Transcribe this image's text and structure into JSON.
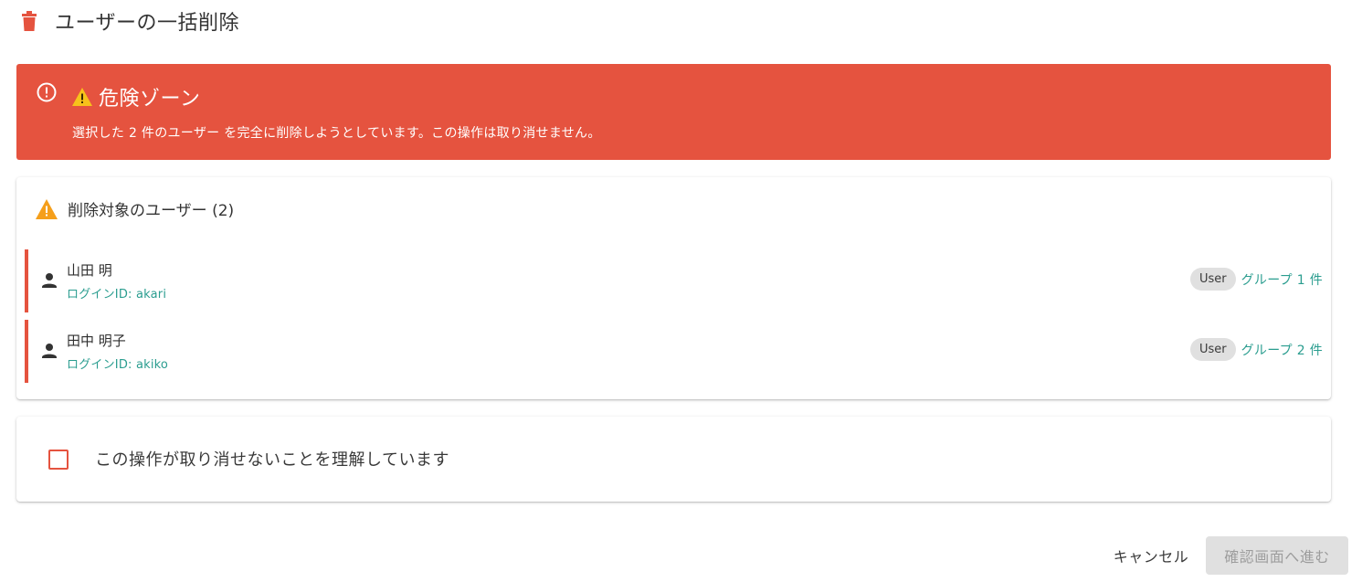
{
  "header": {
    "icon": "trash-icon",
    "title": "ユーザーの一括削除"
  },
  "danger_banner": {
    "icon": "alert-circle-icon",
    "title_icon": "warning-icon",
    "title": "危険ゾーン",
    "message": "選択した 2 件のユーザー を完全に削除しようとしています。この操作は取り消せません。",
    "background_color": "#e5533f"
  },
  "users_card": {
    "icon": "warning-icon",
    "heading": "削除対象のユーザー (2)",
    "users": [
      {
        "name": "山田 明",
        "login": "ログインID: akari",
        "role": "User",
        "groups": "グループ 1 件"
      },
      {
        "name": "田中 明子",
        "login": "ログインID: akiko",
        "role": "User",
        "groups": "グループ 2 件"
      }
    ]
  },
  "confirm": {
    "checked": false,
    "label": "この操作が取り消せないことを理解しています"
  },
  "actions": {
    "cancel_label": "キャンセル",
    "proceed_label": "確認画面へ進む",
    "proceed_disabled": true
  },
  "colors": {
    "danger": "#e5533f",
    "accent_teal": "#2a9d8f",
    "warning_orange": "#f59f1b"
  }
}
